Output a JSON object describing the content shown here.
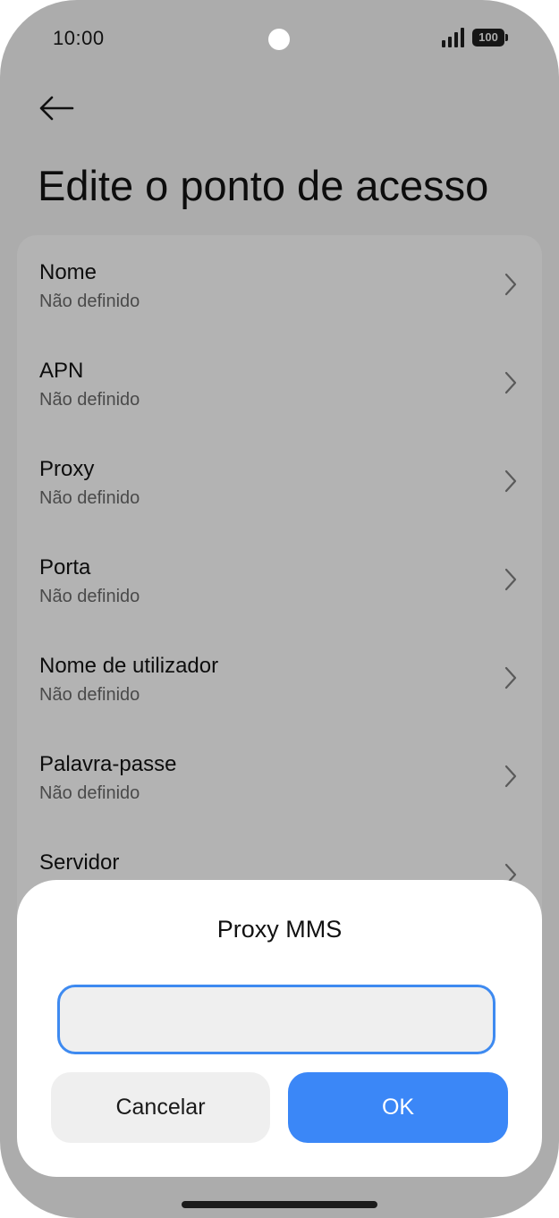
{
  "status_bar": {
    "time": "10:00",
    "battery": "100",
    "icons": [
      "camera-cutout",
      "signal-icon",
      "battery-icon"
    ]
  },
  "header": {
    "back_icon": "back-arrow-icon",
    "title": "Edite o ponto de acesso"
  },
  "settings": {
    "items": [
      {
        "label": "Nome",
        "value": "Não definido"
      },
      {
        "label": "APN",
        "value": "Não definido"
      },
      {
        "label": "Proxy",
        "value": "Não definido"
      },
      {
        "label": "Porta",
        "value": "Não definido"
      },
      {
        "label": "Nome de utilizador",
        "value": "Não definido"
      },
      {
        "label": "Palavra-passe",
        "value": "Não definido"
      },
      {
        "label": "Servidor",
        "value": ""
      }
    ],
    "chevron_icon": "chevron-right-icon"
  },
  "dialog": {
    "title": "Proxy MMS",
    "input_value": "",
    "cancel_label": "Cancelar",
    "ok_label": "OK"
  },
  "colors": {
    "scrim_background": "#acacac",
    "card_background": "#b3b3b3",
    "accent": "#3b87f7",
    "input_border": "#3e8af0"
  }
}
